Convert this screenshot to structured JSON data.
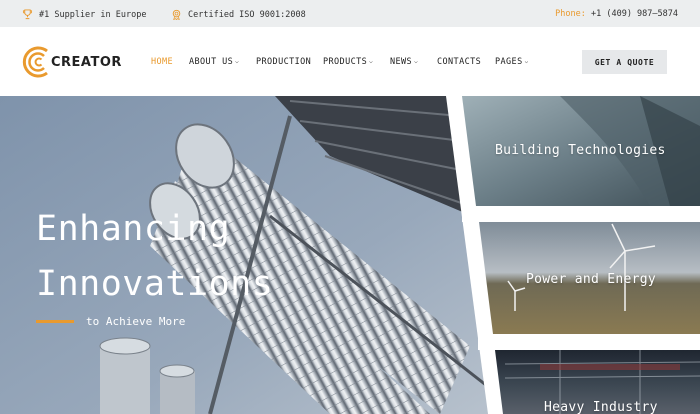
{
  "topbar": {
    "supplier": "#1 Supplier in Europe",
    "certified": "Certified ISO 9001:2008",
    "phone_label": "Phone:",
    "phone_number": "+1 (409) 987–5874"
  },
  "header": {
    "logo_text": "CREATOR",
    "nav": [
      {
        "label": "HOME",
        "active": true
      },
      {
        "label": "ABOUT US",
        "dropdown": true
      },
      {
        "label": "PRODUCTION"
      },
      {
        "label": "PRODUCTS",
        "dropdown": true
      },
      {
        "label": "NEWS",
        "dropdown": true
      },
      {
        "label": "CONTACTS"
      },
      {
        "label": "PAGES",
        "dropdown": true
      }
    ],
    "cta": "GET A QUOTE"
  },
  "hero": {
    "title_line1": "Enhancing",
    "title_line2": "Innovations",
    "subtitle": "to Achieve More",
    "panels": [
      {
        "label": "Building Technologies"
      },
      {
        "label": "Power and Energy"
      },
      {
        "label": "Heavy Industry"
      }
    ]
  },
  "colors": {
    "accent": "#e99a2e",
    "topbar_bg": "#eceeef",
    "button_bg": "#e6e8ea",
    "text_dark": "#222222"
  },
  "icons": [
    "trophy-icon",
    "certificate-icon",
    "caret-down-icon",
    "logo-mark"
  ]
}
